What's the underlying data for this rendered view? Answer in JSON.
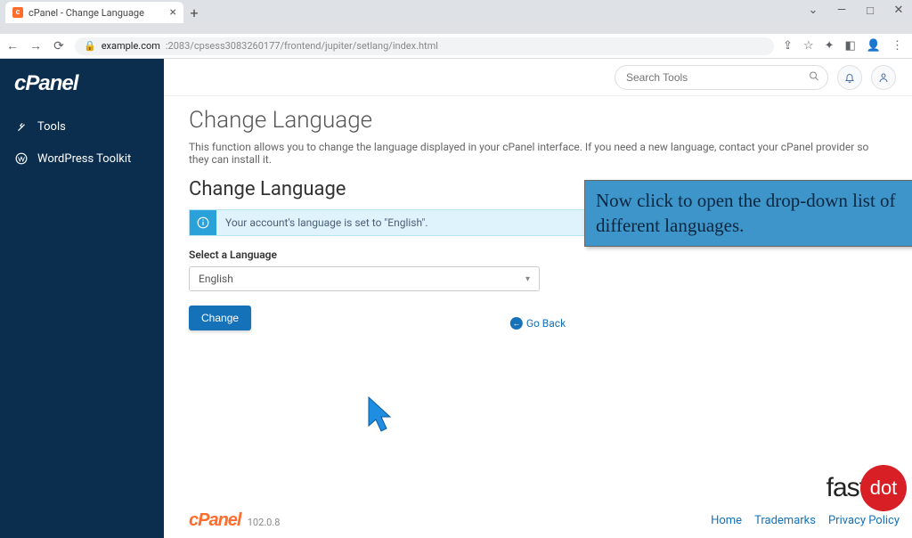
{
  "browser": {
    "tab_title": "cPanel - Change Language",
    "url_host": "example.com",
    "url_path": ":2083/cpsess3083260177/frontend/jupiter/setlang/index.html"
  },
  "sidebar": {
    "brand": "cPanel",
    "items": [
      {
        "label": "Tools"
      },
      {
        "label": "WordPress Toolkit"
      }
    ]
  },
  "topbar": {
    "search_placeholder": "Search Tools"
  },
  "page": {
    "title": "Change Language",
    "description": "This function allows you to change the language displayed in your cPanel interface. If you need a new language, contact your cPanel provider so they can install it.",
    "section_title": "Change Language",
    "info_banner": "Your account's language is set to \"English\".",
    "field_label": "Select a Language",
    "selected_language": "English",
    "change_button": "Change",
    "go_back": "Go Back"
  },
  "footer": {
    "brand": "cPanel",
    "version": "102.0.8",
    "links": [
      "Home",
      "Trademarks",
      "Privacy Policy"
    ]
  },
  "callout": "Now click to open the drop-down list of different languages.",
  "watermark": {
    "fast": "fast",
    "dot": "dot"
  }
}
